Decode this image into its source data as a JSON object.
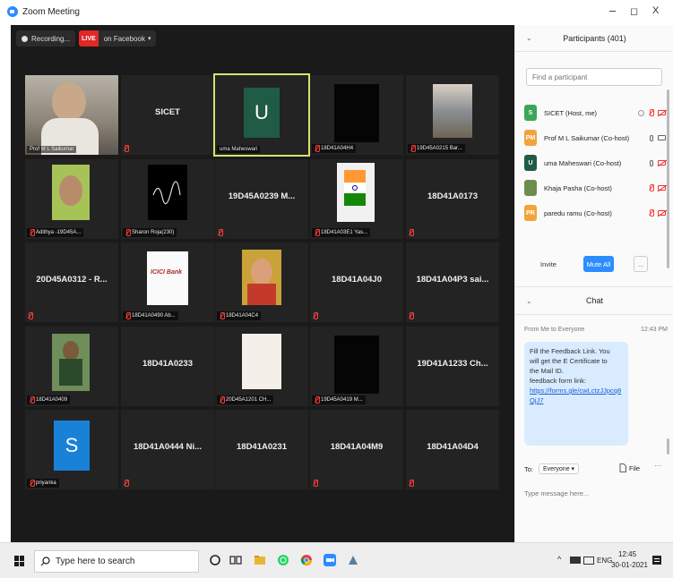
{
  "window": {
    "title": "Zoom Meeting",
    "minimize": "–",
    "maximize": "◻",
    "close": "X"
  },
  "recording": {
    "label": "Recording...",
    "live_tag": "LIVE",
    "live_target": "on Facebook",
    "live_caret": "▾"
  },
  "tiles": [
    {
      "center": "",
      "label": "Prof M L Saikumar",
      "muted": false
    },
    {
      "center": "SICET",
      "label": "",
      "muted": true
    },
    {
      "center": "",
      "label": "uma Maheswari",
      "muted": false
    },
    {
      "center": "",
      "label": "18D41A04H4",
      "muted": true
    },
    {
      "center": "",
      "label": "19D45A0215 Bar...",
      "muted": true
    },
    {
      "center": "",
      "label": "Adithya -19D45A...",
      "muted": true
    },
    {
      "center": "",
      "label": "Sharon Roja(230)",
      "muted": true
    },
    {
      "center": "19D45A0239 M...",
      "label": "",
      "muted": true
    },
    {
      "center": "",
      "label": "18D41A03E1 Yas...",
      "muted": true
    },
    {
      "center": "18D41A0173",
      "label": "",
      "muted": true
    },
    {
      "center": "20D45A0312 - R...",
      "label": "",
      "muted": true
    },
    {
      "center": "",
      "label": "18D41A0490 Ab...",
      "muted": true
    },
    {
      "center": "",
      "label": "18D41A04C4",
      "muted": true
    },
    {
      "center": "18D41A04J0",
      "label": "",
      "muted": true
    },
    {
      "center": "18D41A04P3 sai...",
      "label": "",
      "muted": true
    },
    {
      "center": "",
      "label": "18D41A0409",
      "muted": true
    },
    {
      "center": "18D41A0233",
      "label": "",
      "muted": false
    },
    {
      "center": "",
      "label": "20D45A1201 CH...",
      "muted": true
    },
    {
      "center": "",
      "label": "19D45A0419 M...",
      "muted": true
    },
    {
      "center": "19D41A1233 Ch...",
      "label": "",
      "muted": false
    },
    {
      "center": "",
      "label": "priyanka",
      "muted": true
    },
    {
      "center": "18D41A0444 Ni...",
      "label": "",
      "muted": true
    },
    {
      "center": "18D41A0231",
      "label": "",
      "muted": false
    },
    {
      "center": "18D41A04M9",
      "label": "",
      "muted": true
    },
    {
      "center": "18D41A04D4",
      "label": "",
      "muted": true
    }
  ],
  "avatars": {
    "uma": "U",
    "priyanka": "S",
    "icici": "ICICI Bank"
  },
  "participants": {
    "header": "Participants (401)",
    "search_placeholder": "Find a participant",
    "list": [
      {
        "initials": "S",
        "name": "SICET (Host, me)",
        "color": "#3aa757"
      },
      {
        "initials": "PM",
        "name": "Prof M L Saikumar (Co-host)",
        "color": "#f2a33a"
      },
      {
        "initials": "U",
        "name": "uma Maheswari (Co-host)",
        "color": "#1f5b45"
      },
      {
        "initials": "",
        "name": "Khaja Pasha (Co-host)",
        "color": "#6b8e4e"
      },
      {
        "initials": "PR",
        "name": "paredu ramu (Co-host)",
        "color": "#f2a33a"
      }
    ],
    "invite": "Invite",
    "mute_all": "Mute All",
    "more": "..."
  },
  "chat": {
    "header": "Chat",
    "from": "From Me to Everyone",
    "time": "12:43 PM",
    "message_lines": [
      "Fill the Feedback Link. You",
      "will get the E Certificate to",
      "the Mail ID.",
      "feedback form link:"
    ],
    "link": "https://forms.gle/cwLctzJJpcq8QjJ7",
    "to_label": "To:",
    "to_value": "Everyone ▾",
    "file": "File",
    "more": "···",
    "input_placeholder": "Type message here..."
  },
  "taskbar": {
    "search_placeholder": "Type here to search",
    "lang": "ENG",
    "time": "12:45",
    "date": "30-01-2021",
    "caret": "^"
  },
  "colors": {
    "meeting_bg": "#1a1a1a",
    "tile_bg": "#232323",
    "active_outline": "#d8e36a",
    "mute_red": "#ff3b3b",
    "mute_all_blue": "#2d8cff",
    "bubble": "#d9ebff"
  }
}
